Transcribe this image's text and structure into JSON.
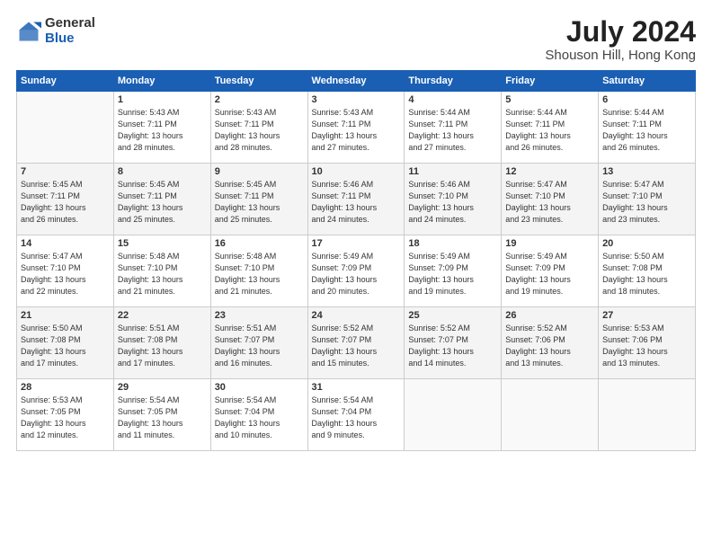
{
  "header": {
    "logo_general": "General",
    "logo_blue": "Blue",
    "title": "July 2024",
    "subtitle": "Shouson Hill, Hong Kong"
  },
  "days_of_week": [
    "Sunday",
    "Monday",
    "Tuesday",
    "Wednesday",
    "Thursday",
    "Friday",
    "Saturday"
  ],
  "weeks": [
    [
      {
        "num": "",
        "info": ""
      },
      {
        "num": "1",
        "info": "Sunrise: 5:43 AM\nSunset: 7:11 PM\nDaylight: 13 hours\nand 28 minutes."
      },
      {
        "num": "2",
        "info": "Sunrise: 5:43 AM\nSunset: 7:11 PM\nDaylight: 13 hours\nand 28 minutes."
      },
      {
        "num": "3",
        "info": "Sunrise: 5:43 AM\nSunset: 7:11 PM\nDaylight: 13 hours\nand 27 minutes."
      },
      {
        "num": "4",
        "info": "Sunrise: 5:44 AM\nSunset: 7:11 PM\nDaylight: 13 hours\nand 27 minutes."
      },
      {
        "num": "5",
        "info": "Sunrise: 5:44 AM\nSunset: 7:11 PM\nDaylight: 13 hours\nand 26 minutes."
      },
      {
        "num": "6",
        "info": "Sunrise: 5:44 AM\nSunset: 7:11 PM\nDaylight: 13 hours\nand 26 minutes."
      }
    ],
    [
      {
        "num": "7",
        "info": "Sunrise: 5:45 AM\nSunset: 7:11 PM\nDaylight: 13 hours\nand 26 minutes."
      },
      {
        "num": "8",
        "info": "Sunrise: 5:45 AM\nSunset: 7:11 PM\nDaylight: 13 hours\nand 25 minutes."
      },
      {
        "num": "9",
        "info": "Sunrise: 5:45 AM\nSunset: 7:11 PM\nDaylight: 13 hours\nand 25 minutes."
      },
      {
        "num": "10",
        "info": "Sunrise: 5:46 AM\nSunset: 7:11 PM\nDaylight: 13 hours\nand 24 minutes."
      },
      {
        "num": "11",
        "info": "Sunrise: 5:46 AM\nSunset: 7:10 PM\nDaylight: 13 hours\nand 24 minutes."
      },
      {
        "num": "12",
        "info": "Sunrise: 5:47 AM\nSunset: 7:10 PM\nDaylight: 13 hours\nand 23 minutes."
      },
      {
        "num": "13",
        "info": "Sunrise: 5:47 AM\nSunset: 7:10 PM\nDaylight: 13 hours\nand 23 minutes."
      }
    ],
    [
      {
        "num": "14",
        "info": "Sunrise: 5:47 AM\nSunset: 7:10 PM\nDaylight: 13 hours\nand 22 minutes."
      },
      {
        "num": "15",
        "info": "Sunrise: 5:48 AM\nSunset: 7:10 PM\nDaylight: 13 hours\nand 21 minutes."
      },
      {
        "num": "16",
        "info": "Sunrise: 5:48 AM\nSunset: 7:10 PM\nDaylight: 13 hours\nand 21 minutes."
      },
      {
        "num": "17",
        "info": "Sunrise: 5:49 AM\nSunset: 7:09 PM\nDaylight: 13 hours\nand 20 minutes."
      },
      {
        "num": "18",
        "info": "Sunrise: 5:49 AM\nSunset: 7:09 PM\nDaylight: 13 hours\nand 19 minutes."
      },
      {
        "num": "19",
        "info": "Sunrise: 5:49 AM\nSunset: 7:09 PM\nDaylight: 13 hours\nand 19 minutes."
      },
      {
        "num": "20",
        "info": "Sunrise: 5:50 AM\nSunset: 7:08 PM\nDaylight: 13 hours\nand 18 minutes."
      }
    ],
    [
      {
        "num": "21",
        "info": "Sunrise: 5:50 AM\nSunset: 7:08 PM\nDaylight: 13 hours\nand 17 minutes."
      },
      {
        "num": "22",
        "info": "Sunrise: 5:51 AM\nSunset: 7:08 PM\nDaylight: 13 hours\nand 17 minutes."
      },
      {
        "num": "23",
        "info": "Sunrise: 5:51 AM\nSunset: 7:07 PM\nDaylight: 13 hours\nand 16 minutes."
      },
      {
        "num": "24",
        "info": "Sunrise: 5:52 AM\nSunset: 7:07 PM\nDaylight: 13 hours\nand 15 minutes."
      },
      {
        "num": "25",
        "info": "Sunrise: 5:52 AM\nSunset: 7:07 PM\nDaylight: 13 hours\nand 14 minutes."
      },
      {
        "num": "26",
        "info": "Sunrise: 5:52 AM\nSunset: 7:06 PM\nDaylight: 13 hours\nand 13 minutes."
      },
      {
        "num": "27",
        "info": "Sunrise: 5:53 AM\nSunset: 7:06 PM\nDaylight: 13 hours\nand 13 minutes."
      }
    ],
    [
      {
        "num": "28",
        "info": "Sunrise: 5:53 AM\nSunset: 7:05 PM\nDaylight: 13 hours\nand 12 minutes."
      },
      {
        "num": "29",
        "info": "Sunrise: 5:54 AM\nSunset: 7:05 PM\nDaylight: 13 hours\nand 11 minutes."
      },
      {
        "num": "30",
        "info": "Sunrise: 5:54 AM\nSunset: 7:04 PM\nDaylight: 13 hours\nand 10 minutes."
      },
      {
        "num": "31",
        "info": "Sunrise: 5:54 AM\nSunset: 7:04 PM\nDaylight: 13 hours\nand 9 minutes."
      },
      {
        "num": "",
        "info": ""
      },
      {
        "num": "",
        "info": ""
      },
      {
        "num": "",
        "info": ""
      }
    ]
  ]
}
